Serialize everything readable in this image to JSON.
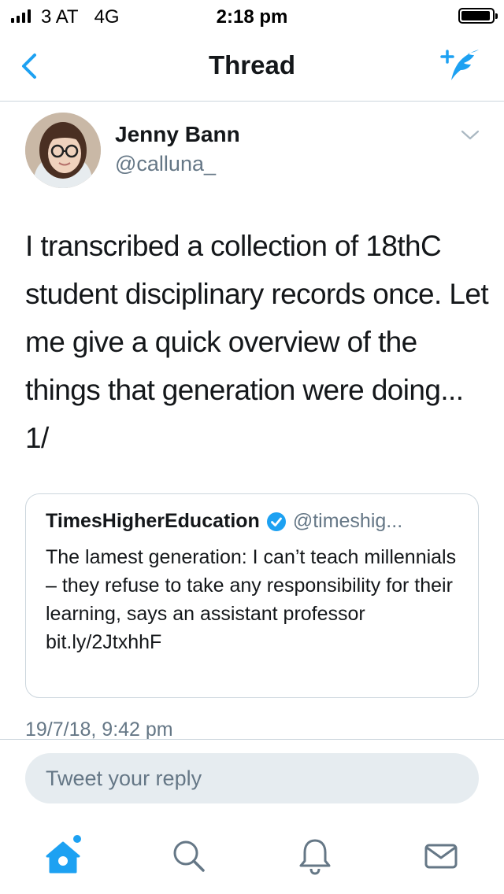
{
  "status_bar": {
    "carrier": "3 AT",
    "network": "4G",
    "time": "2:18 pm"
  },
  "nav": {
    "title": "Thread",
    "back_icon": "chevron-left-icon",
    "compose_icon": "compose-tweet-icon"
  },
  "tweet": {
    "author_name": "Jenny Bann",
    "author_handle": "@calluna_",
    "text": "I transcribed a collection of 18thC student disciplinary records once. Let me give a quick overview of the things that generation were doing... 1/",
    "timestamp": "19/7/18, 9:42 pm"
  },
  "quoted_tweet": {
    "author_name": "TimesHigherEducation",
    "verified": true,
    "author_handle": "@timeshig...",
    "text": "The lamest generation: I can’t teach millennials – they refuse to take any responsibility for their learning, says an assistant professor",
    "link": "bit.ly/2JtxhhF"
  },
  "reply": {
    "placeholder": "Tweet your reply"
  },
  "tabs": [
    {
      "name": "home",
      "icon": "home-icon",
      "active": true
    },
    {
      "name": "search",
      "icon": "search-icon",
      "active": false
    },
    {
      "name": "notifications",
      "icon": "bell-icon",
      "active": false
    },
    {
      "name": "messages",
      "icon": "mail-icon",
      "active": false
    }
  ],
  "colors": {
    "accent": "#1da1f2",
    "secondary_text": "#657786",
    "divider": "#ccd6dd",
    "reply_bg": "#e6ecf0"
  }
}
